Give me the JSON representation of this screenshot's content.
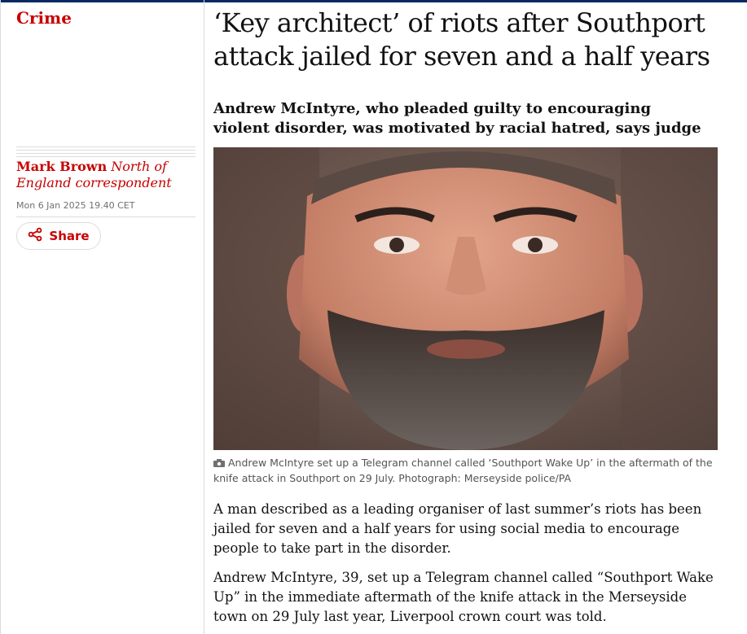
{
  "section": {
    "label": "Crime"
  },
  "article": {
    "headline": "‘Key architect’ of riots after Southport attack jailed for seven and a half years",
    "standfirst": "Andrew McIntyre, who pleaded guilty to encouraging violent disorder, was motivated by racial hatred, says judge",
    "byline": {
      "name": "Mark Brown",
      "role": "North of England correspondent"
    },
    "dateline": "Mon 6 Jan 2025 19.40 CET",
    "share_label": "Share",
    "image": {
      "caption": "Andrew McIntyre set up a Telegram channel called ‘Southport Wake Up’ in the aftermath of the knife attack in Southport on 29 July. Photograph: Merseyside police/PA"
    },
    "paragraphs": [
      "A man described as a leading organiser of last summer’s riots has been jailed for seven and a half years for using social media to encourage people to take part in the disorder.",
      "Andrew McIntyre, 39, set up a Telegram channel called “Southport Wake Up” in the immediate aftermath of the knife attack in the Merseyside town on 29 July last year, Liverpool crown court was told."
    ]
  },
  "colors": {
    "accent": "#c70000",
    "topbar": "#052962",
    "text": "#121212",
    "muted": "#707070",
    "border": "#dcdcdc"
  },
  "icons": {
    "share": "share-icon",
    "camera": "camera-icon"
  }
}
